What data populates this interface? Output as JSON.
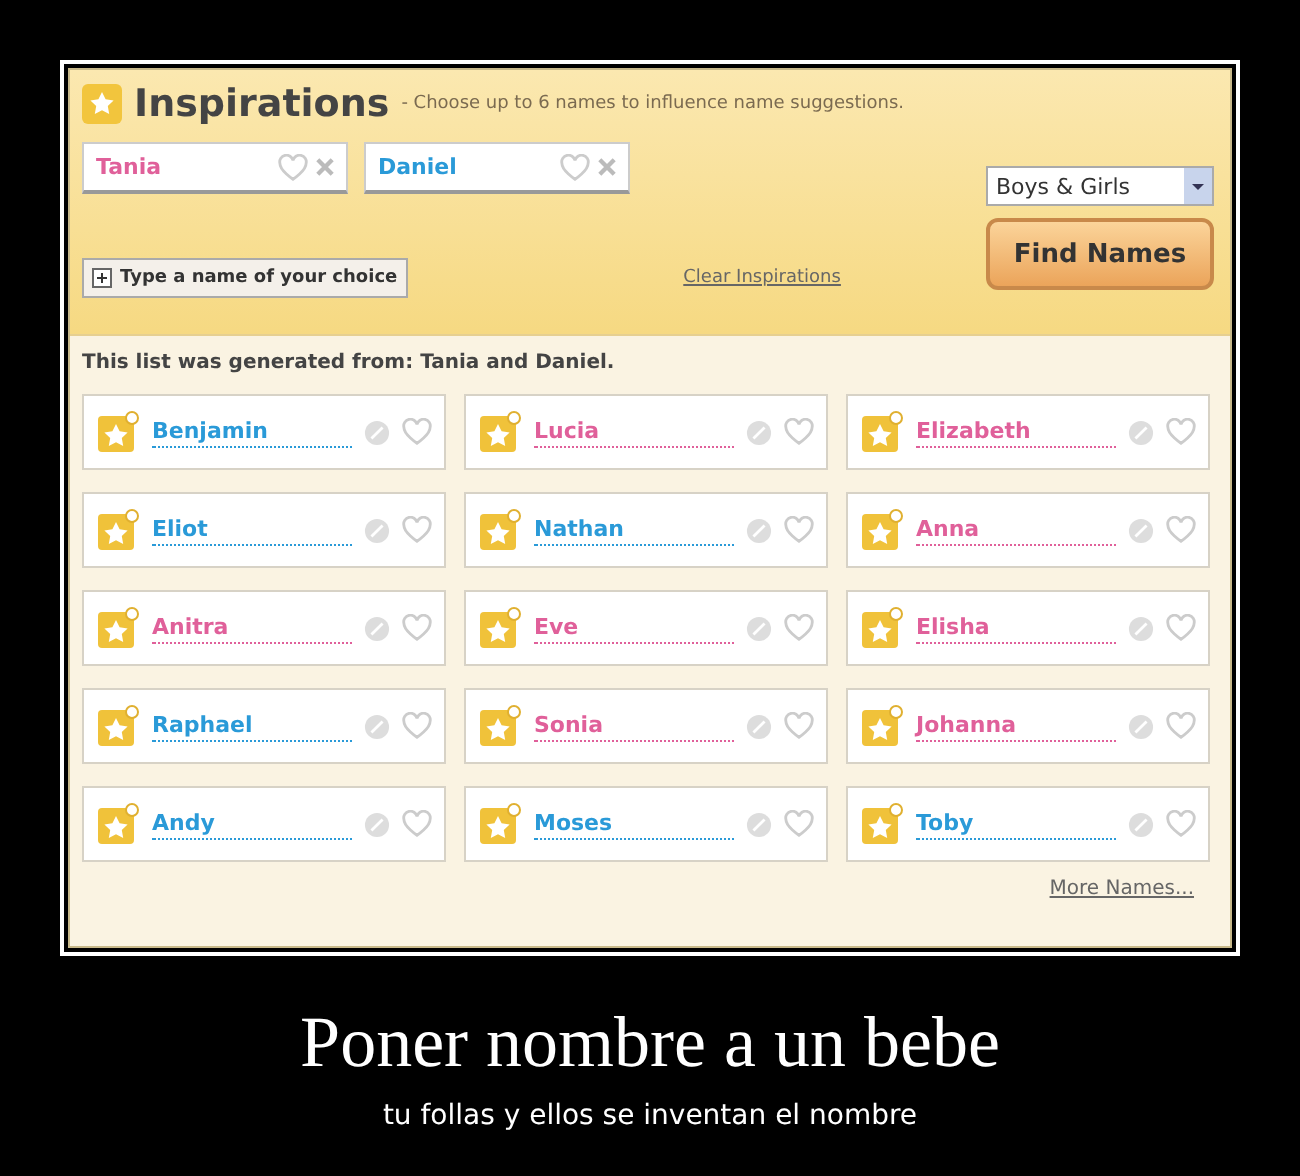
{
  "header": {
    "title": "Inspirations",
    "subtitle": "- Choose up to 6 names to influence name suggestions."
  },
  "inspirations": [
    {
      "name": "Tania",
      "color": "#e0609a"
    },
    {
      "name": "Daniel",
      "color": "#2a9ad8"
    }
  ],
  "gender_select": {
    "value": "Boys & Girls"
  },
  "find_button": "Find Names",
  "add_name": "Type a name of your choice",
  "clear_link": "Clear Inspirations",
  "generated_from": "This list was generated from: Tania and Daniel.",
  "names": [
    {
      "name": "Benjamin",
      "color": "#2a9ad8"
    },
    {
      "name": "Lucia",
      "color": "#e0609a"
    },
    {
      "name": "Elizabeth",
      "color": "#e0609a"
    },
    {
      "name": "Eliot",
      "color": "#2a9ad8"
    },
    {
      "name": "Nathan",
      "color": "#2a9ad8"
    },
    {
      "name": "Anna",
      "color": "#e0609a"
    },
    {
      "name": "Anitra",
      "color": "#e0609a"
    },
    {
      "name": "Eve",
      "color": "#e0609a"
    },
    {
      "name": "Elisha",
      "color": "#e0609a"
    },
    {
      "name": "Raphael",
      "color": "#2a9ad8"
    },
    {
      "name": "Sonia",
      "color": "#e0609a"
    },
    {
      "name": "Johanna",
      "color": "#e0609a"
    },
    {
      "name": "Andy",
      "color": "#2a9ad8"
    },
    {
      "name": "Moses",
      "color": "#2a9ad8"
    },
    {
      "name": "Toby",
      "color": "#2a9ad8"
    }
  ],
  "more_link": "More Names...",
  "caption": {
    "title": "Poner nombre a un bebe",
    "subtitle": "tu follas y ellos se inventan el nombre"
  }
}
